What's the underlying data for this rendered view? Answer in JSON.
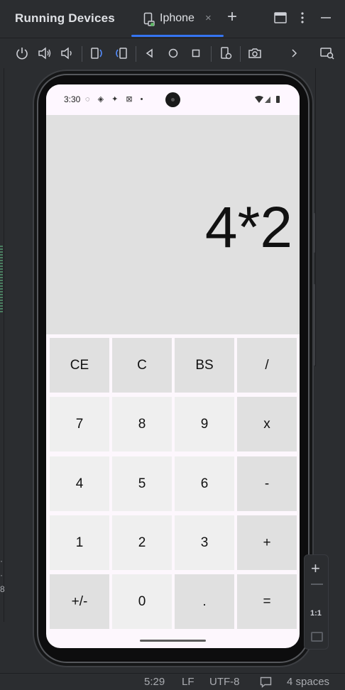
{
  "titlebar": {
    "title": "Running Devices",
    "tab_label": "Iphone",
    "tab_close": "×",
    "add_tab": "+",
    "icons": [
      "layout-icon",
      "more-vertical-icon",
      "minimize-icon"
    ]
  },
  "toolbar": {
    "buttons": [
      "power-icon",
      "volume-up-icon",
      "volume-down-icon",
      "rotate-left-icon",
      "rotate-right-icon",
      "back-icon",
      "home-icon",
      "overview-icon",
      "device-settings-icon",
      "screenshot-icon",
      "chevron-right-icon",
      "search-window-icon"
    ]
  },
  "phone": {
    "time": "3:30",
    "status_icons": "◌ ◈ ✦ ⊠ •",
    "display_value": "4*2",
    "keys": [
      {
        "label": "CE",
        "kind": "op"
      },
      {
        "label": "C",
        "kind": "op"
      },
      {
        "label": "BS",
        "kind": "op"
      },
      {
        "label": "/",
        "kind": "op"
      },
      {
        "label": "7",
        "kind": "num"
      },
      {
        "label": "8",
        "kind": "num"
      },
      {
        "label": "9",
        "kind": "num"
      },
      {
        "label": "x",
        "kind": "op"
      },
      {
        "label": "4",
        "kind": "num"
      },
      {
        "label": "5",
        "kind": "num"
      },
      {
        "label": "6",
        "kind": "num"
      },
      {
        "label": "-",
        "kind": "op"
      },
      {
        "label": "1",
        "kind": "num"
      },
      {
        "label": "2",
        "kind": "num"
      },
      {
        "label": "3",
        "kind": "num"
      },
      {
        "label": "+",
        "kind": "op"
      },
      {
        "label": "+/-",
        "kind": "op"
      },
      {
        "label": "0",
        "kind": "num"
      },
      {
        "label": ".",
        "kind": "op"
      },
      {
        "label": "=",
        "kind": "op"
      }
    ]
  },
  "zoom": {
    "plus": "+",
    "one_to_one": "1:1"
  },
  "statusbar": {
    "position": "5:29",
    "line_ending": "LF",
    "encoding": "UTF-8",
    "indent": "4 spaces"
  },
  "colors": {
    "accent": "#3574f0",
    "ide_bg": "#2b2d30",
    "display_bg": "#e0e0e0",
    "operator_key": "#e0e0e0",
    "number_key": "#efefef"
  }
}
